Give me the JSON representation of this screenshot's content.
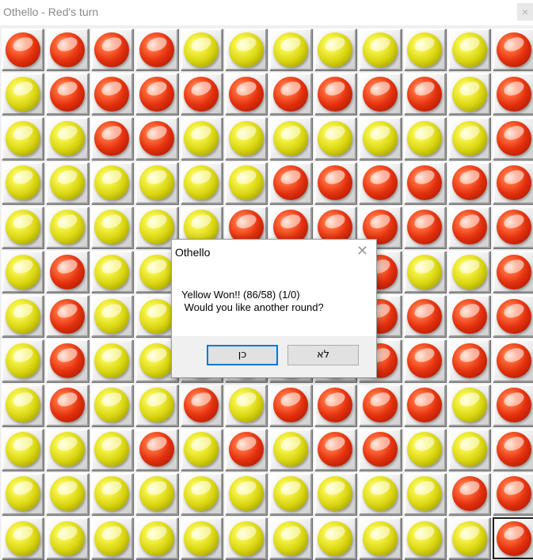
{
  "window": {
    "title": "Othello - Red's turn",
    "close_glyph": "×"
  },
  "board": {
    "size": 12,
    "colors": {
      "red": "#e3310e",
      "yellow": "#d8d410"
    },
    "highlight_cell": [
      11,
      11
    ],
    "rows": [
      "RRRRYYYYYYYR",
      "YRRRRRRRRRYR",
      "YYRRYYYYYYYR",
      "YYYYYYRRRRRR",
      "YYYYYRRRRRRR",
      "YRYYYYYYRYYR",
      "YRYYYYYYRRRR",
      "YRYYYYRYRRRR",
      "YRYYRYRRRRYR",
      "YYYRYRYRRYYR",
      "YYYYYYYYYYRR",
      "YYYYYYYYYYYR"
    ]
  },
  "dialog": {
    "title": "Othello",
    "close_glyph": "✕",
    "message_line1": "Yellow Won!! (86/58) (1/0)",
    "message_line2": " Would you like another round?",
    "yes_label": "כן",
    "no_label": "לא"
  }
}
